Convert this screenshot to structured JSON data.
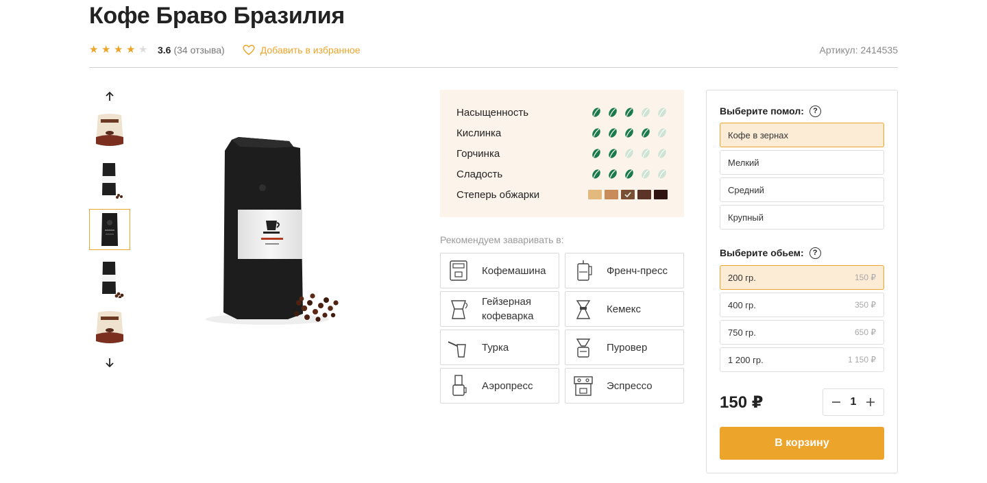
{
  "product": {
    "title": "Кофе Браво Бразилия",
    "rating": "3.6",
    "rating_value": 3.6,
    "reviews": "(34 отзыва)",
    "favorite_label": "Добавить в избранное",
    "sku": "Артикул: 2414535"
  },
  "colors": {
    "accent": "#eda42a",
    "bean_on": "#1a7a4a",
    "bean_off": "#cde3d3",
    "panel_bg": "#fcf3ea",
    "selected_bg": "#fcecd5"
  },
  "gallery": {
    "up_icon": "arrow-up-icon",
    "down_icon": "arrow-down-icon",
    "thumbnails": [
      "bag-beige",
      "bag-black-small",
      "bag-black",
      "bag-black-side",
      "bag-beige"
    ],
    "active_index": 2
  },
  "characteristics": [
    {
      "label": "Насыщенность",
      "level": 3,
      "max": 5
    },
    {
      "label": "Кислинка",
      "level": 4,
      "max": 5
    },
    {
      "label": "Горчинка",
      "level": 2,
      "max": 5
    },
    {
      "label": "Сладость",
      "level": 3,
      "max": 5
    }
  ],
  "roast": {
    "label": "Степерь обжарки",
    "shades": [
      "#e3b97d",
      "#c88c5a",
      "#7a5035",
      "#5c3327",
      "#2f1512"
    ],
    "selected_index": 2
  },
  "brewing": {
    "label": "Рекомендуем заваривать в:",
    "methods": [
      {
        "label": "Кофемашина",
        "icon": "coffee-machine-icon"
      },
      {
        "label": "Френч-пресс",
        "icon": "french-press-icon"
      },
      {
        "label": "Гейзерная кофеварка",
        "icon": "moka-pot-icon"
      },
      {
        "label": "Кемекс",
        "icon": "chemex-icon"
      },
      {
        "label": "Турка",
        "icon": "turka-icon"
      },
      {
        "label": "Пуровер",
        "icon": "pourover-icon"
      },
      {
        "label": "Аэропресс",
        "icon": "aeropress-icon"
      },
      {
        "label": "Эспрессо",
        "icon": "espresso-icon"
      }
    ]
  },
  "grind": {
    "label": "Выберите помол:",
    "options": [
      "Кофе в зернах",
      "Мелкий",
      "Средний",
      "Крупный"
    ],
    "selected_index": 0
  },
  "volume": {
    "label": "Выберите обьем:",
    "options": [
      {
        "label": "200 гр.",
        "price": "150 ₽"
      },
      {
        "label": "400 гр.",
        "price": "350 ₽"
      },
      {
        "label": "750 гр.",
        "price": "650 ₽"
      },
      {
        "label": "1 200 гр.",
        "price": "1 150 ₽"
      }
    ],
    "selected_index": 0
  },
  "purchase": {
    "price": "150 ₽",
    "quantity": "1",
    "cart_label": "В корзину"
  }
}
